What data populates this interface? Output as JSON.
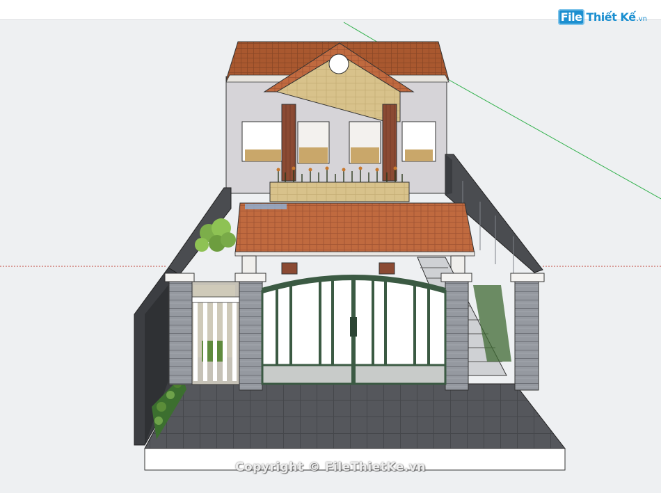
{
  "watermark": {
    "logo_badge": "File",
    "logo_rest": "Thiết Kế",
    "logo_tld": ".vn",
    "copyright": "Copyright © FileThietKe.vn"
  },
  "colors": {
    "background": "#eef0f2",
    "roof_tile": "#b5653d",
    "wall": "#d5d3d6",
    "stone_pillar": "#8c8f96",
    "gate_green": "#3b5a43",
    "pavement": "#55575c",
    "axis_green": "#2fb04a",
    "axis_red": "#c0463c"
  },
  "icons": {
    "model_axis_green": "green-axis-line-icon",
    "model_axis_red": "red-axis-line-icon"
  }
}
